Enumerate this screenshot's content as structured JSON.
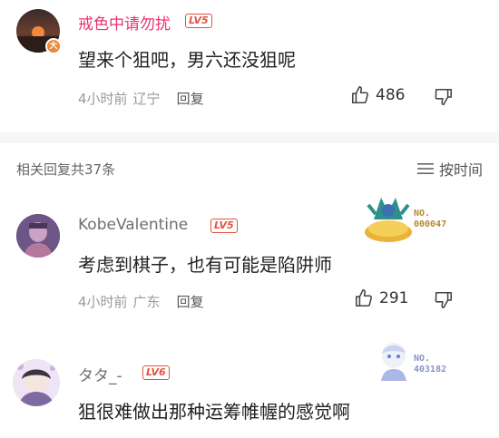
{
  "top_comment": {
    "username": "戒色中请勿扰",
    "level": "LV5",
    "text": "望来个狙吧，男六还没狙呢",
    "time": "4小时前",
    "location": "辽宁",
    "reply_label": "回复",
    "likes": "486",
    "avatar_badge": "大"
  },
  "replies_header": {
    "title": "相关回复共37条",
    "sort_label": "按时间"
  },
  "replies": [
    {
      "username": "KobeValentine",
      "level": "LV5",
      "text": "考虑到棋子，也有可能是陷阱师",
      "time": "4小时前",
      "location": "广东",
      "reply_label": "回复",
      "likes": "291",
      "medal_no_label": "NO.",
      "medal_number": "000047"
    },
    {
      "username": "タタ_-",
      "level": "LV6",
      "text": "狙很难做出那种运筹帷幄的感觉啊",
      "medal_no_label": "NO.",
      "medal_number": "403182"
    }
  ],
  "colors": {
    "accent_pink": "#e8336e",
    "level_red": "#e4513f",
    "meta_gray": "#9a9a9a"
  }
}
